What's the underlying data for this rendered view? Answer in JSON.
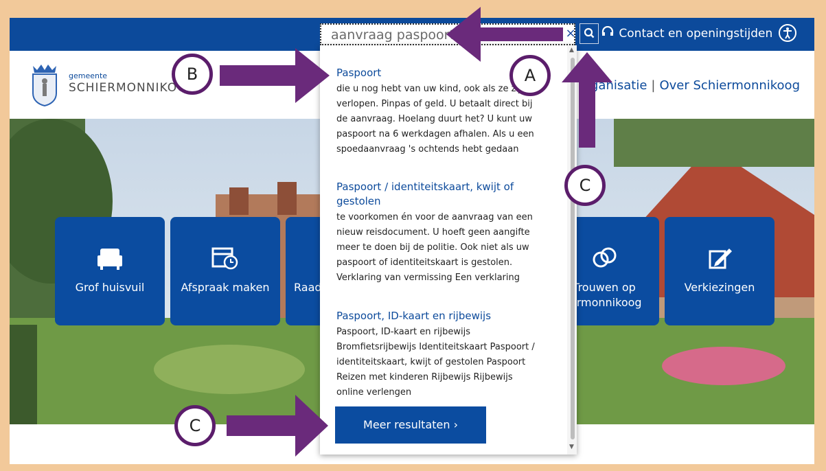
{
  "topbar": {
    "search_value": "aanvraag paspoort",
    "clear_symbol": "×",
    "contact_label": "Contact en openingstijden"
  },
  "header": {
    "logo_small": "gemeente",
    "logo_big": "SCHIERMONNIKOOG",
    "nav_partial": "ganisatie",
    "nav_separator": "|",
    "nav_item": "Over Schiermonnikoog"
  },
  "tiles": [
    {
      "label": "Grof huisvuil",
      "icon": "armchair-icon"
    },
    {
      "label": "Afspraak maken",
      "icon": "calendar-clock-icon"
    },
    {
      "label": "Raad",
      "icon": "council-icon"
    },
    {
      "label": "Trouwen op\niermonnikoog",
      "icon": "rings-icon"
    },
    {
      "label": "Verkiezingen",
      "icon": "ballot-pen-icon"
    }
  ],
  "dropdown": {
    "results": [
      {
        "title": "Paspoort",
        "body": "die u nog hebt van uw kind, ook als ze zijn verlopen. Pinpas of geld. U betaalt direct bij de aanvraag. Hoelang duurt het? U kunt uw paspoort na 6 werkdagen afhalen. Als u een spoedaanvraag 's ochtends hebt gedaan"
      },
      {
        "title": "Paspoort / identiteitskaart, kwijt of gestolen",
        "body": "te voorkomen én voor de aanvraag van een nieuw reisdocument. U hoeft geen aangifte meer te doen bij de politie. Ook niet als uw paspoort of identiteitskaart is gestolen. Verklaring van vermissing Een verklaring"
      },
      {
        "title": "Paspoort, ID-kaart en rijbewijs",
        "body": "Paspoort, ID-kaart en rijbewijs Bromfietsrijbewijs Identiteitskaart Paspoort / identiteitskaart, kwijt of gestolen Paspoort Reizen met kinderen Rijbewijs Rijbewijs online verlengen"
      }
    ],
    "more_label": "Meer resultaten ›"
  },
  "annotations": {
    "a": "A",
    "b": "B",
    "c1": "C",
    "c2": "C",
    "arrow_color": "#6a2a7b"
  },
  "colors": {
    "brand_blue": "#0c4a9b",
    "frame": "#f2c99a"
  }
}
